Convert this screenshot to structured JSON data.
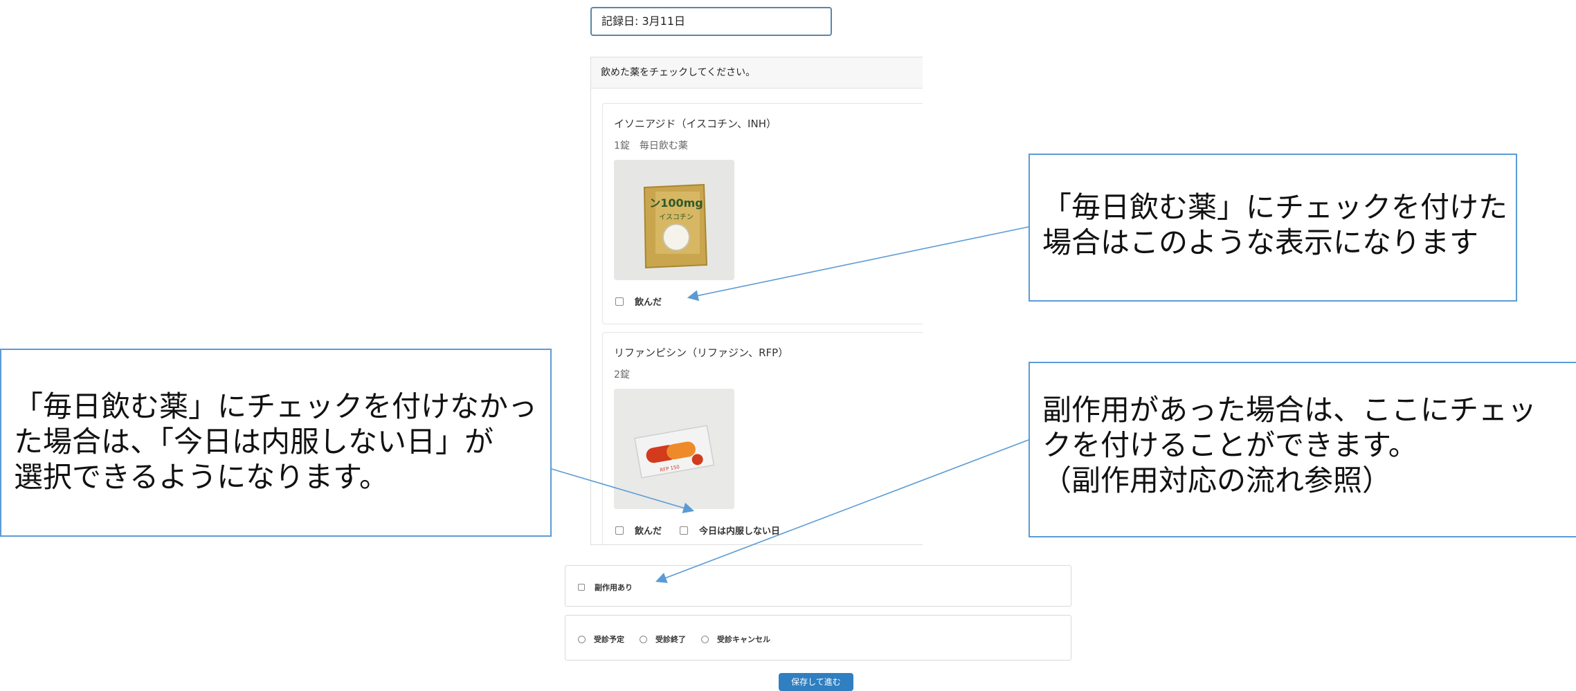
{
  "date_field": {
    "value": "記録日: 3月11日"
  },
  "panel": {
    "header": "飲めた薬をチェックしてください。"
  },
  "medications": [
    {
      "name": "イソニアジド（イスコチン、INH）",
      "dose": "1錠　毎日飲む薬",
      "photo_label": "ン100mg",
      "photo_sub": "イスコチン",
      "checkboxes": [
        "飲んだ"
      ]
    },
    {
      "name": "リファンピシン（リファジン、RFP）",
      "dose": "2錠",
      "photo_label": "RFP 150",
      "checkboxes": [
        "飲んだ",
        "今日は内服しない日"
      ]
    }
  ],
  "side_effect": {
    "label": "副作用あり"
  },
  "visit": {
    "options": [
      "受診予定",
      "受診終了",
      "受診キャンセル"
    ]
  },
  "save_button": {
    "label": "保存して進む"
  },
  "callouts": {
    "right_top": [
      "「毎日飲む薬」にチェックを付けた",
      "場合はこのような表示になります"
    ],
    "left": [
      "「毎日飲む薬」にチェックを付けなかっ",
      "た場合は、「今日は内服しない日」が",
      "選択できるようになります。"
    ],
    "right_bottom": [
      "副作用があった場合は、ここにチェッ",
      "クを付けることができます。",
      "（副作用対応の流れ参照）"
    ]
  },
  "colors": {
    "callout_border": "#5b9bd5",
    "arrow": "#5b9bd5",
    "button": "#2f7fc1",
    "date_border": "#5a86a8"
  }
}
